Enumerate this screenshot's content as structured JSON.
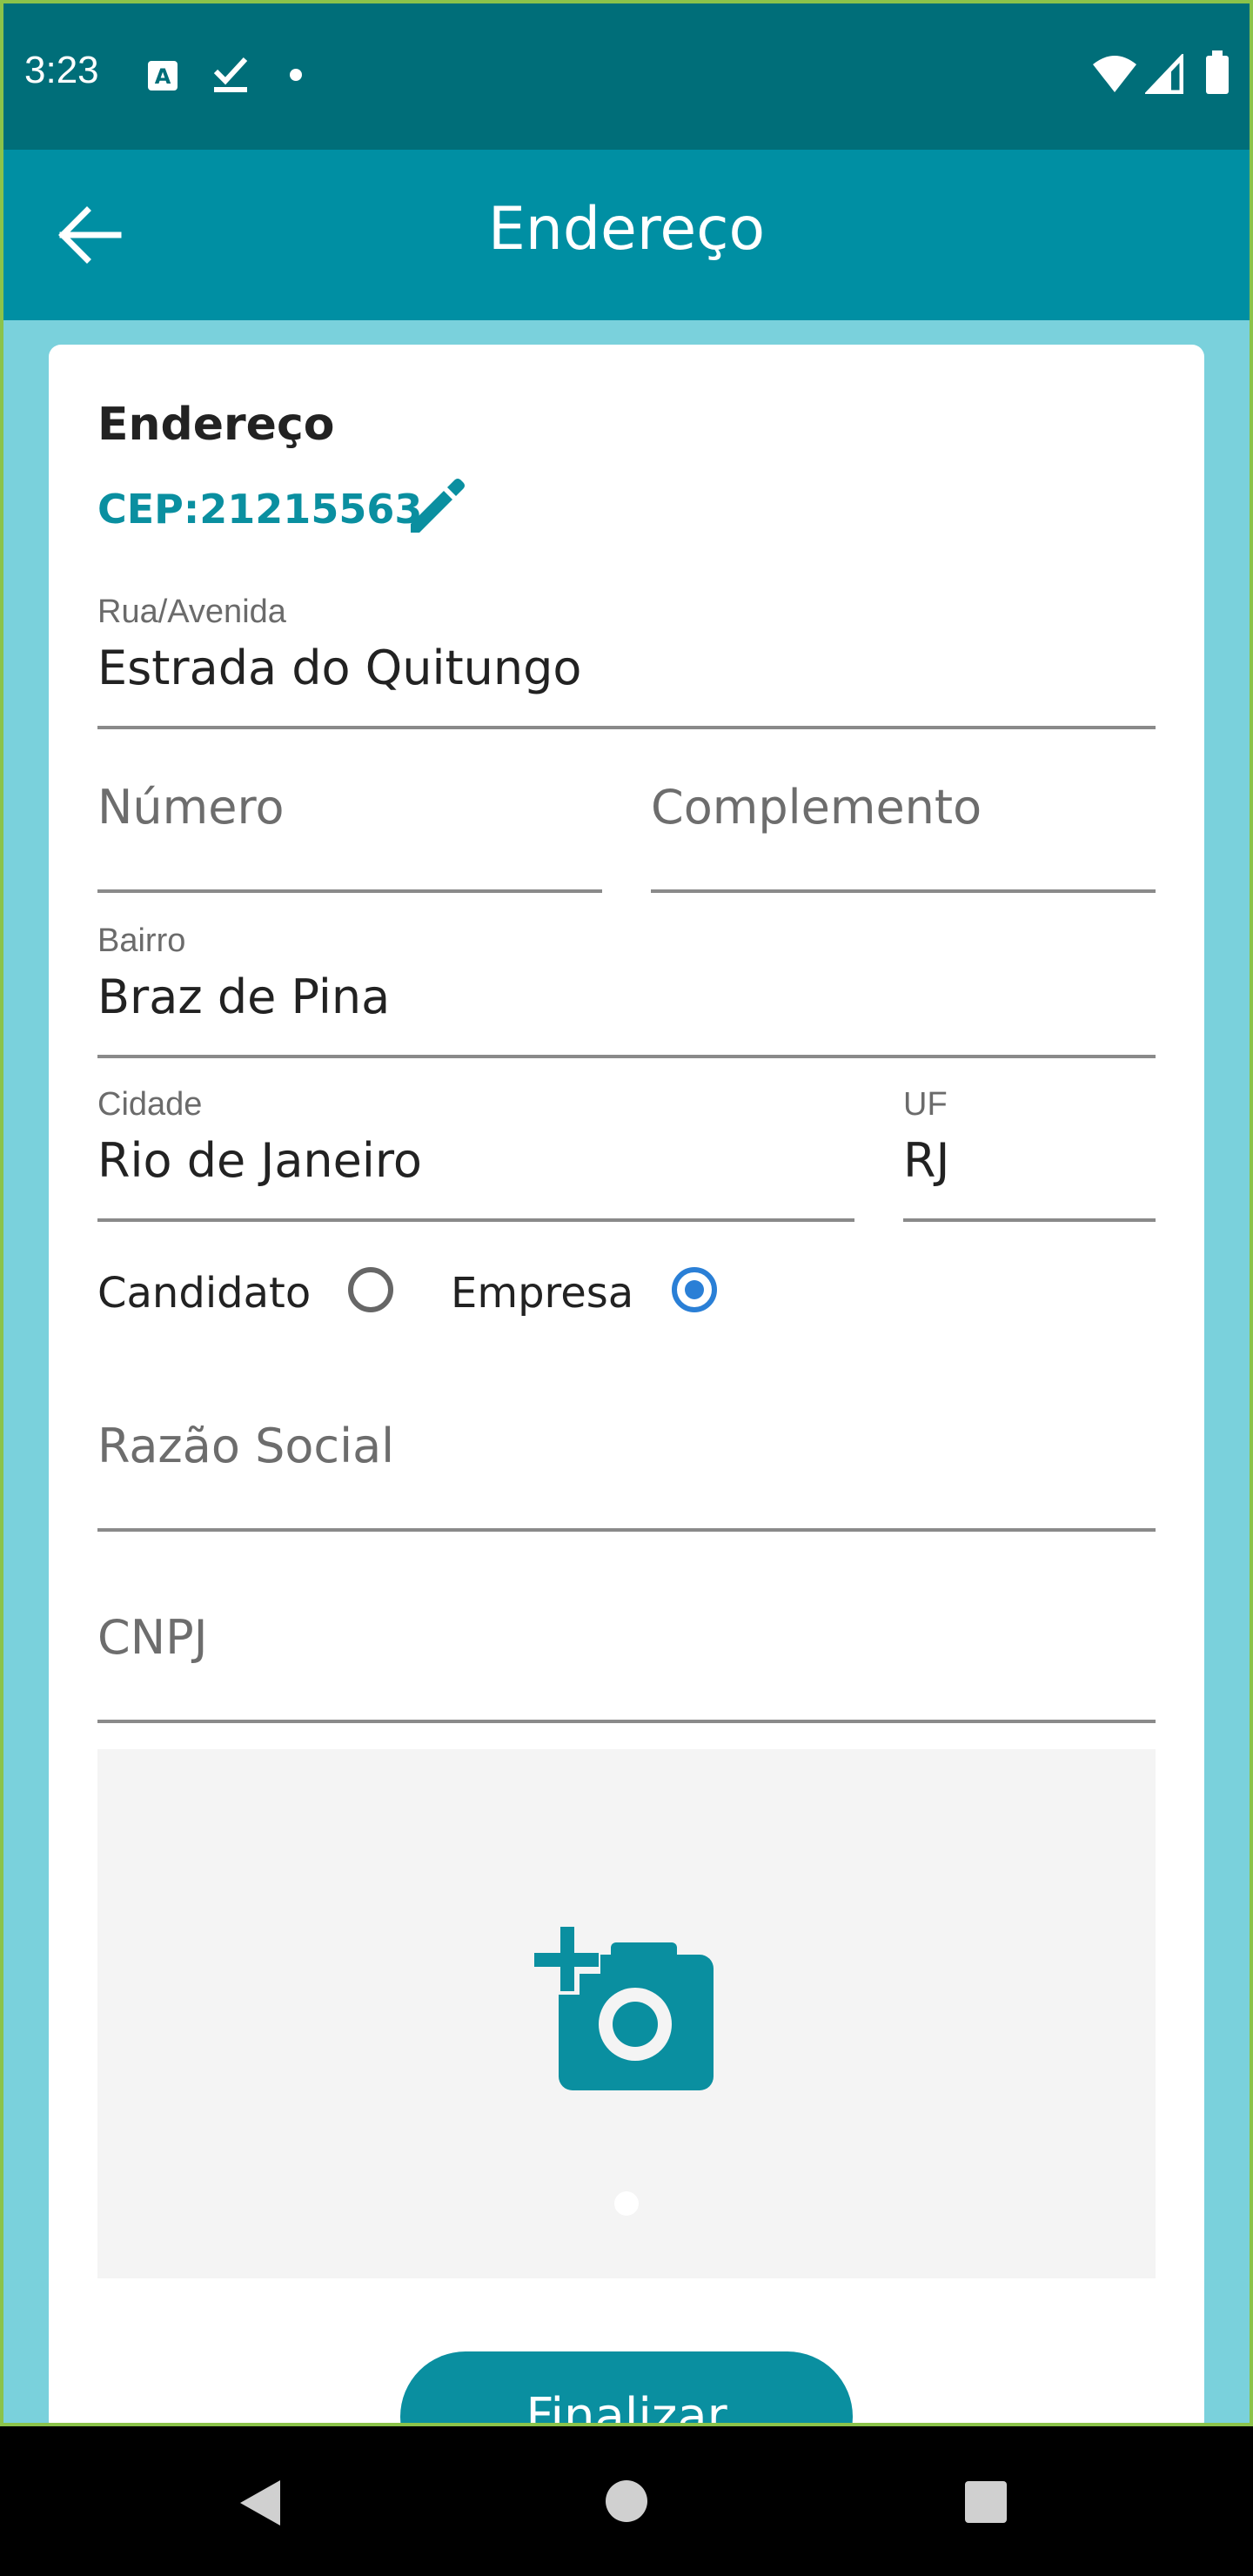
{
  "status_bar": {
    "time": "3:23",
    "icons": [
      "a-keyboard-icon",
      "check-icon",
      "dot-icon",
      "wifi-icon",
      "signal-icon",
      "battery-icon"
    ]
  },
  "app_bar": {
    "title": "Endereço",
    "back_icon": "arrow-back-icon"
  },
  "form": {
    "section_title": "Endereço",
    "cep": "CEP:21215563",
    "street": {
      "label": "Rua/Avenida",
      "value": "Estrada do Quitungo"
    },
    "number": {
      "placeholder": "Número"
    },
    "complement": {
      "placeholder": "Complemento"
    },
    "neighborhood": {
      "label": "Bairro",
      "value": "Braz de Pina"
    },
    "city": {
      "label": "Cidade",
      "value": "Rio de Janeiro"
    },
    "state": {
      "label": "UF",
      "value": "RJ"
    },
    "type_options": [
      {
        "label": "Candidato",
        "selected": false
      },
      {
        "label": "Empresa",
        "selected": true
      }
    ],
    "company_name": {
      "placeholder": "Razão Social"
    },
    "cnpj": {
      "placeholder": "CNPJ"
    },
    "photo_icon": "add-photo-icon",
    "finish_label": "Finalizar"
  },
  "colors": {
    "status_bar": "#006e79",
    "app_bar": "#008fa3",
    "accent": "#0a8fa0",
    "background": "#7ad1dc",
    "radio_selected": "#2a7fd6"
  },
  "nav_bar": {
    "icons": [
      "back-triangle-icon",
      "home-circle-icon",
      "recents-square-icon"
    ]
  }
}
